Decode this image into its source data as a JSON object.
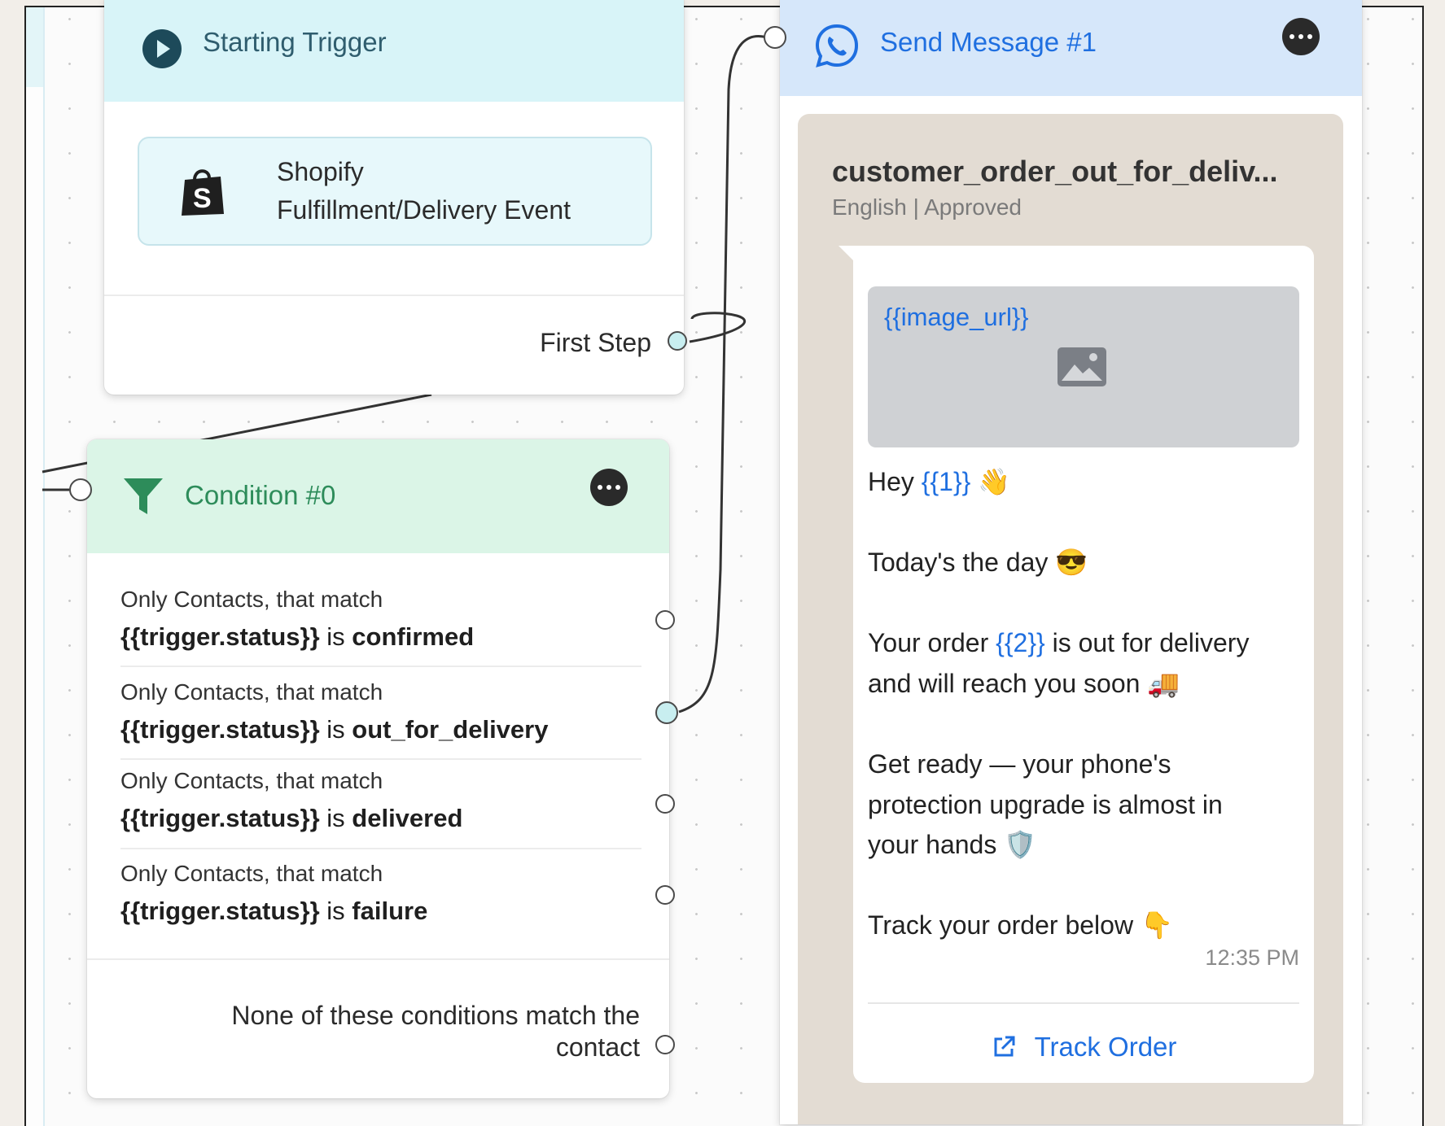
{
  "trigger": {
    "title": "Starting Trigger",
    "event_line1": "Shopify",
    "event_line2": "Fulfillment/Delivery Event",
    "port_label": "First Step"
  },
  "condition": {
    "title": "Condition #0",
    "rules": [
      {
        "prefix": "Only Contacts, that match",
        "field": "{{trigger.status}}",
        "op": "is",
        "value": "confirmed"
      },
      {
        "prefix": "Only Contacts, that match",
        "field": "{{trigger.status}}",
        "op": "is",
        "value": "out_for_delivery"
      },
      {
        "prefix": "Only Contacts, that match",
        "field": "{{trigger.status}}",
        "op": "is",
        "value": "delivered"
      },
      {
        "prefix": "Only Contacts, that match",
        "field": "{{trigger.status}}",
        "op": "is",
        "value": "failure"
      }
    ],
    "fallback_line1": "None of these conditions match the",
    "fallback_line2": "contact"
  },
  "message": {
    "title": "Send Message #1",
    "template_name": "customer_order_out_for_deliv...",
    "template_meta": "English | Approved",
    "media_var": "{{image_url}}",
    "lines": {
      "l1a": "Hey ",
      "l1var": "{{1}}",
      "l1emoji": "👋",
      "l2": "Today's the day ",
      "l2emoji": "😎",
      "l3a": "Your order ",
      "l3var": "{{2}}",
      "l3b": " is out for delivery",
      "l4": "and will reach you soon ",
      "l4emoji": "🚚",
      "l5": "Get ready — your phone's",
      "l6": "protection upgrade is almost in",
      "l7": "your hands ",
      "l7emoji": "🛡️",
      "l8": "Track your order below ",
      "l8emoji": "👇"
    },
    "time": "12:35 PM",
    "cta_label": "Track Order"
  },
  "colors": {
    "trigger_header": "#d8f4f8",
    "condition_header": "#dbf5e7",
    "message_header": "#d6e7fa",
    "link_blue": "#1f6fe0",
    "condition_green": "#2d8c5a"
  },
  "icons": {
    "trigger": "play-circle-icon",
    "event": "shopify-bag-icon",
    "condition": "funnel-icon",
    "message": "whatsapp-icon",
    "media": "image-placeholder-icon",
    "cta": "external-link-icon",
    "menu": "more-options-icon"
  }
}
